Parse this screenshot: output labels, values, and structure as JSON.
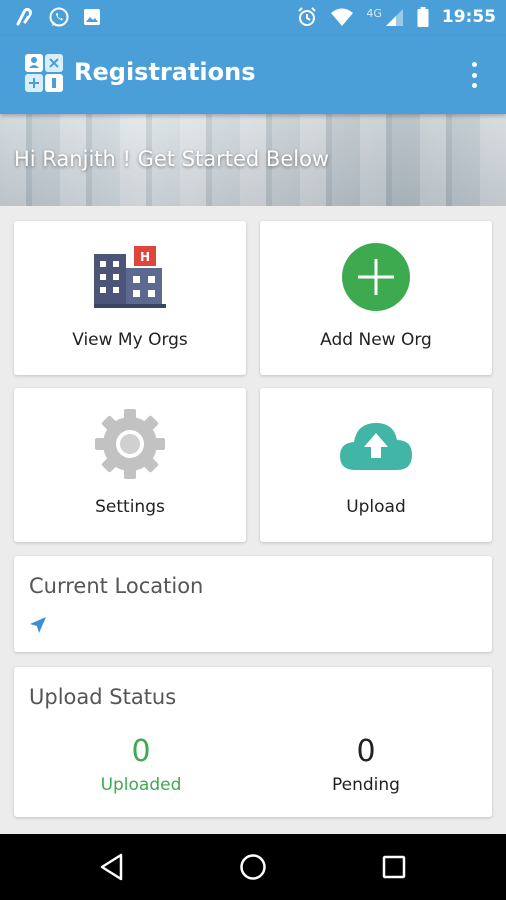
{
  "status_bar": {
    "time": "19:55",
    "network": "4G",
    "left_icons": [
      "app-notification-icon",
      "whatsapp-icon",
      "image-icon"
    ],
    "right_icons": [
      "alarm-icon",
      "wifi-icon",
      "cellular-signal-icon",
      "battery-icon"
    ]
  },
  "app_bar": {
    "title": "Registrations",
    "color": "#4a9fd8"
  },
  "banner": {
    "greeting": "Hi Ranjith ! Get Started Below"
  },
  "tiles": [
    {
      "label": "View My Orgs",
      "icon": "hospital-building-icon"
    },
    {
      "label": "Add New Org",
      "icon": "add-circle-icon",
      "color": "#3daa4f"
    },
    {
      "label": "Settings",
      "icon": "gear-icon",
      "color": "#c2c2c2"
    },
    {
      "label": "Upload",
      "icon": "cloud-upload-icon",
      "color": "#41b6a6"
    }
  ],
  "current_location": {
    "title": "Current Location",
    "icon": "navigation-arrow-icon"
  },
  "upload_status": {
    "title": "Upload Status",
    "uploaded": {
      "value": "0",
      "label": "Uploaded",
      "color": "#3daa4f"
    },
    "pending": {
      "value": "0",
      "label": "Pending",
      "color": "#222222"
    }
  },
  "nav_bar": {
    "buttons": [
      "back-icon",
      "home-icon",
      "recents-icon"
    ]
  }
}
